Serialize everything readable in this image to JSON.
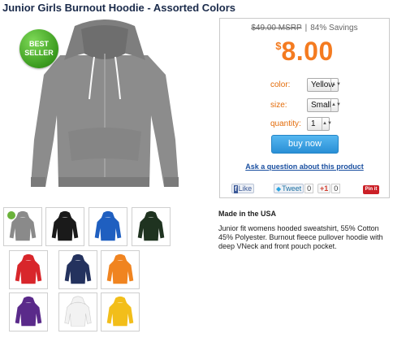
{
  "product": {
    "title": "Junior Girls Burnout Hoodie - Assorted Colors",
    "badge": "BEST SELLER",
    "made_in": "Made in the USA",
    "description": "Junior fit womens hooded sweatshirt, 55% Cotton 45% Polyester. Burnout fleece pullover hoodie with deep VNeck and front pouch pocket."
  },
  "pricing": {
    "msrp": "$49.00 MSRP",
    "separator": "|",
    "savings": "84% Savings",
    "currency": "$",
    "price": "8.00",
    "accent_color": "#f47b20"
  },
  "options": {
    "color_label": "color:",
    "color_value": "Yellow",
    "size_label": "size:",
    "size_value": "Small",
    "quantity_label": "quantity:",
    "quantity_value": "1"
  },
  "actions": {
    "buy_label": "buy now",
    "ask_link": "Ask a question about this product"
  },
  "share": {
    "like_label": "Like",
    "like_count": "",
    "tweet_label": "Tweet",
    "tweet_count": "0",
    "gplus_label": "+1",
    "gplus_count": "0",
    "pin_label": "Pin it"
  },
  "thumbnails": [
    {
      "color": "#8a8a8a",
      "new": true
    },
    {
      "color": "#1a1a1a",
      "new": false
    },
    {
      "color": "#1f5fc0",
      "new": false
    },
    {
      "color": "#1f3320",
      "new": false
    },
    {
      "color": "#d8262b",
      "new": false
    },
    {
      "color": "#24325e",
      "new": false
    },
    {
      "color": "#f08420",
      "new": false
    },
    {
      "color": "#5a2a8a",
      "new": false
    },
    {
      "color": "#f2f2f2",
      "new": false
    },
    {
      "color": "#f2be1a",
      "new": false
    }
  ]
}
